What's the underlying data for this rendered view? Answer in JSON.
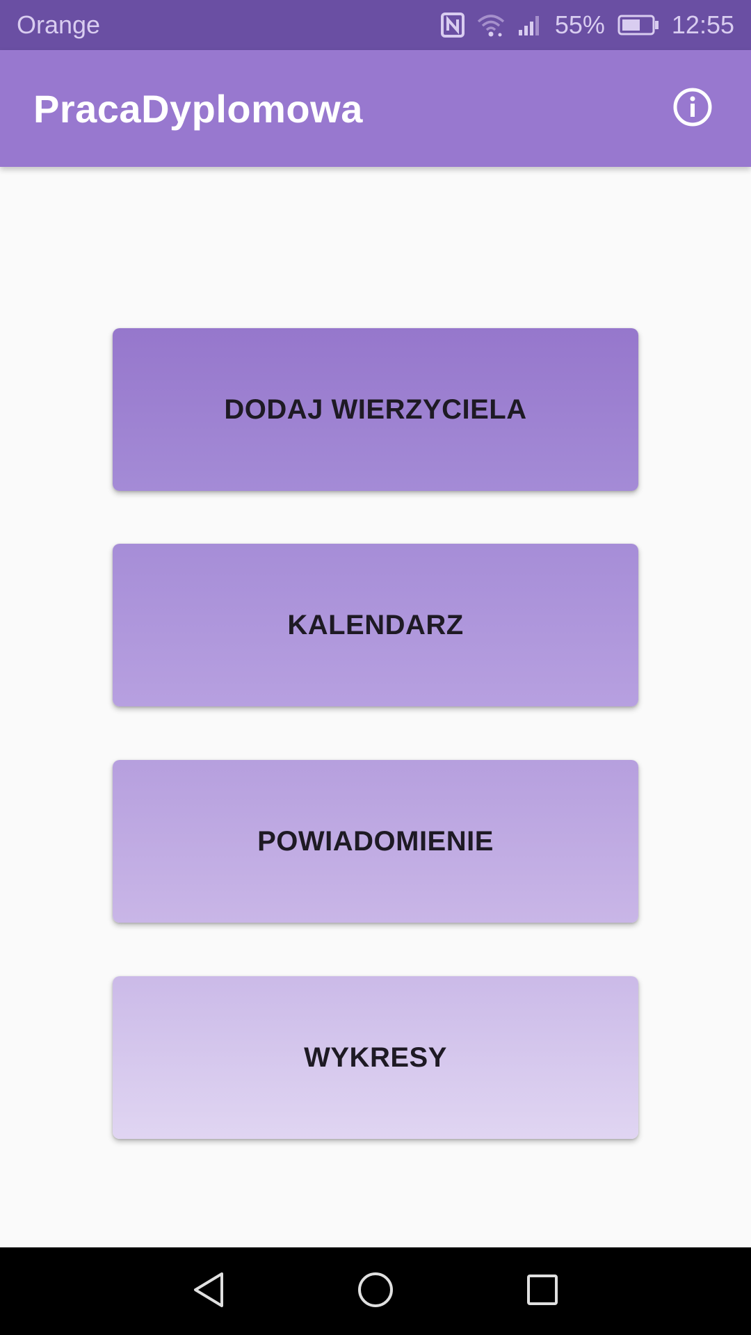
{
  "status_bar": {
    "carrier": "Orange",
    "battery": "55%",
    "time": "12:55",
    "icons": [
      "nfc-icon",
      "wifi-icon",
      "signal-icon",
      "battery-icon"
    ]
  },
  "app_bar": {
    "title": "PracaDyplomowa",
    "action_icon": "info-icon"
  },
  "menu": {
    "buttons": [
      {
        "label": "DODAJ WIERZYCIELA"
      },
      {
        "label": "KALENDARZ"
      },
      {
        "label": "POWIADOMIENIE"
      },
      {
        "label": "WYKRESY"
      }
    ]
  },
  "nav_bar": {
    "icons": [
      "back-icon",
      "home-icon",
      "recents-icon"
    ]
  },
  "colors": {
    "status_bar": "#6a4fa3",
    "app_bar": "#9878cf",
    "background": "#fafafa",
    "button_text": "#1e1a24"
  }
}
